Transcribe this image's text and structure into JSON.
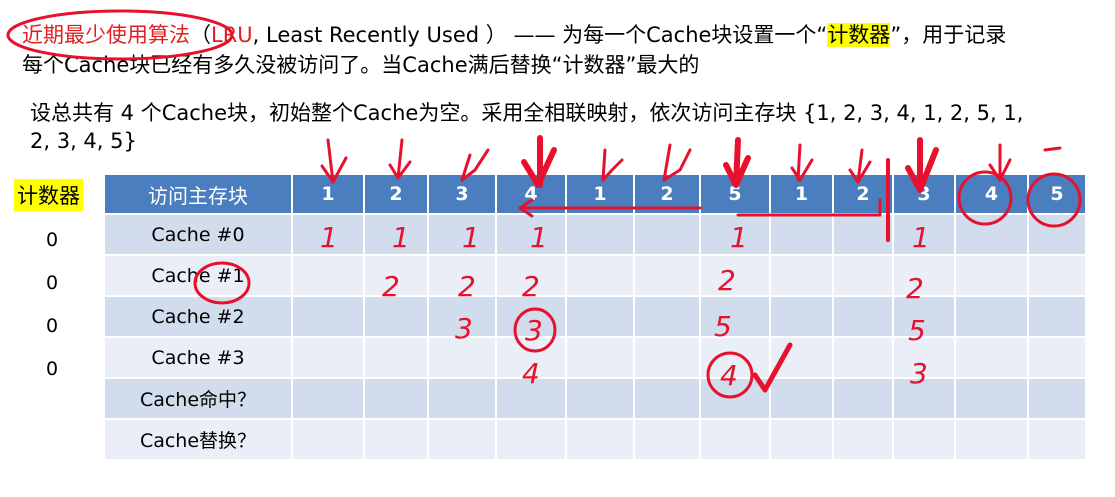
{
  "intro": {
    "term": "近期最少使用算法",
    "paren_open": "（",
    "abbr": "LRU",
    "full_name": ", Least Recently Used ）",
    "dash": "—— 为每一个Cache块设置一个“",
    "counter_word": "计数器",
    "rest1": "”，用于记录",
    "line2": "每个Cache块已经有多久没被访问了。当Cache满后替换“计数器”最大的"
  },
  "problem": {
    "line1": "设总共有 4 个Cache块，初始整个Cache为空。采用全相联映射，依次访问主存块 {1, 2, 3, 4, 1, 2, 5, 1,",
    "line2": "2, 3, 4, 5}"
  },
  "counter_title": "计数器",
  "counter_values": [
    "0",
    "0",
    "0",
    "0"
  ],
  "table": {
    "header_label": "访问主存块",
    "sequence": [
      "1",
      "2",
      "3",
      "4",
      "1",
      "2",
      "5",
      "1",
      "2",
      "3",
      "4",
      "5"
    ],
    "row_labels": [
      "Cache #0",
      "Cache #1",
      "Cache #2",
      "Cache #3",
      "Cache命中？",
      "Cache替换？"
    ]
  },
  "handwritten": {
    "row0": [
      {
        "col": 0,
        "text": "1"
      },
      {
        "col": 1,
        "text": "1"
      },
      {
        "col": 2,
        "text": "1"
      },
      {
        "col": 3,
        "text": "1"
      },
      {
        "col": 6,
        "text": "1"
      },
      {
        "col": 9,
        "text": "1"
      }
    ],
    "row1": [
      {
        "col": 1,
        "text": "2"
      },
      {
        "col": 2,
        "text": "2"
      },
      {
        "col": 3,
        "text": "2"
      },
      {
        "col": 6,
        "text": "2"
      },
      {
        "col": 9,
        "text": "2"
      }
    ],
    "row2": [
      {
        "col": 2,
        "text": "3"
      },
      {
        "col": 3,
        "text": "3"
      },
      {
        "col": 6,
        "text": "5"
      },
      {
        "col": 9,
        "text": "5"
      }
    ],
    "row3": [
      {
        "col": 3,
        "text": "4"
      },
      {
        "col": 6,
        "text": "4"
      },
      {
        "col": 9,
        "text": "3"
      }
    ],
    "ink_color": "#e8112d"
  }
}
